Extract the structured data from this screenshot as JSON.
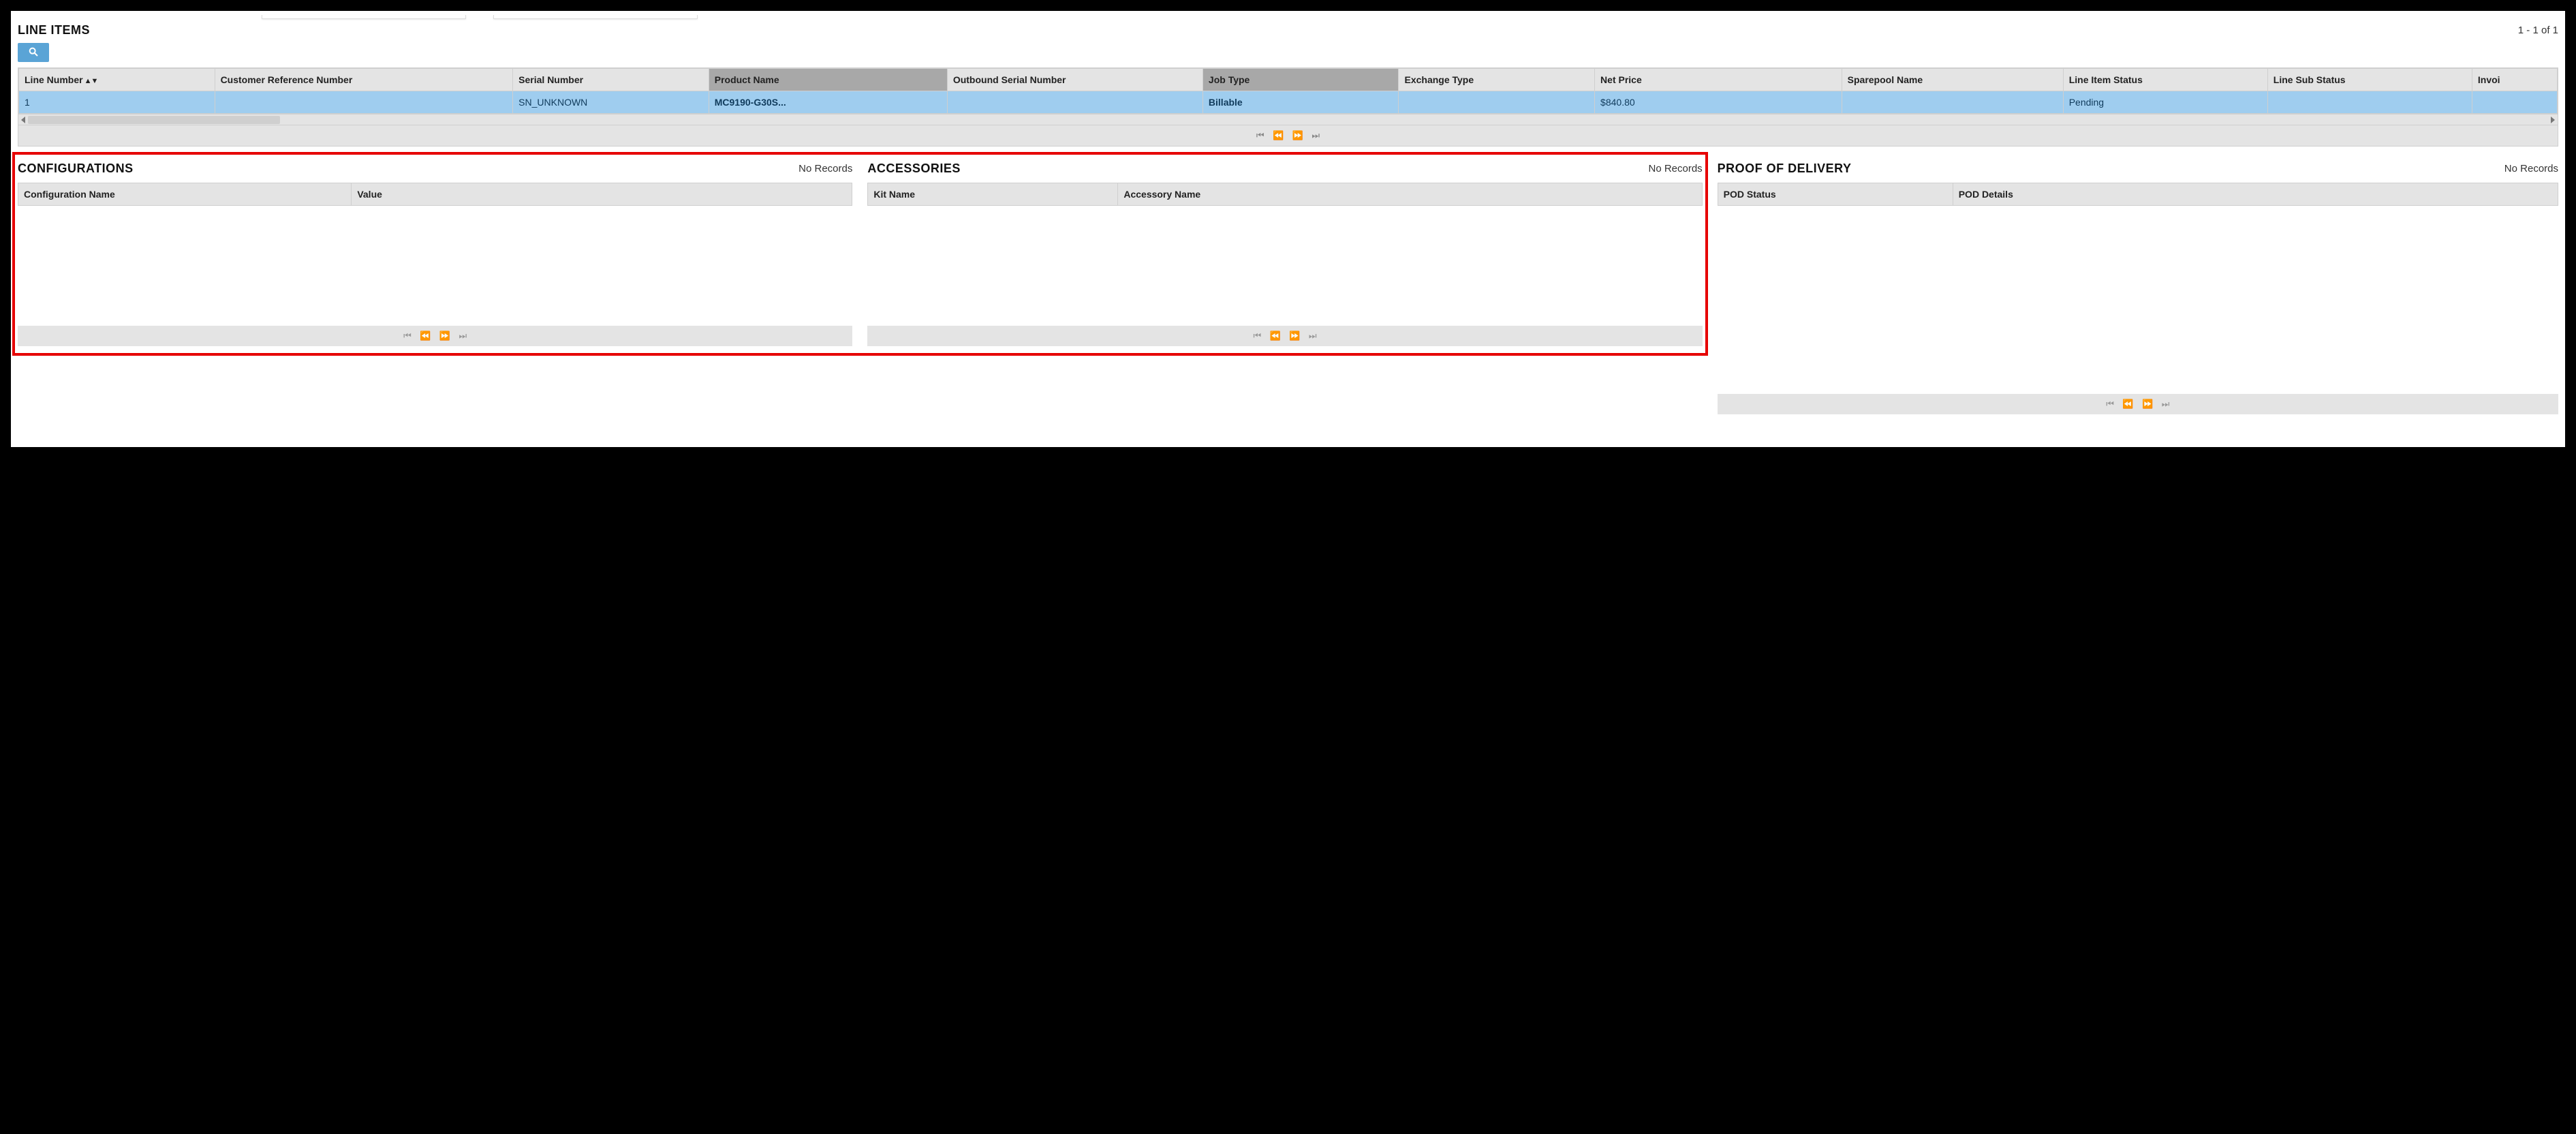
{
  "line_items": {
    "title": "LINE ITEMS",
    "status": "1 - 1 of 1",
    "columns": {
      "line_number": "Line Number",
      "customer_ref": "Customer Reference Number",
      "serial_number": "Serial Number",
      "product_name": "Product Name",
      "outbound_serial": "Outbound Serial Number",
      "job_type": "Job Type",
      "exchange_type": "Exchange Type",
      "net_price": "Net Price",
      "sparepool_name": "Sparepool Name",
      "line_item_status": "Line Item Status",
      "line_sub_status": "Line Sub Status",
      "invoice": "Invoi"
    },
    "row": {
      "line_number": "1",
      "customer_ref": "",
      "serial_number": "SN_UNKNOWN",
      "product_name": "MC9190-G30S...",
      "outbound_serial": "",
      "job_type": "Billable",
      "exchange_type": "",
      "net_price": "$840.80",
      "sparepool_name": "",
      "line_item_status": "Pending",
      "line_sub_status": "",
      "invoice": ""
    }
  },
  "configurations": {
    "title": "CONFIGURATIONS",
    "status": "No Records",
    "columns": {
      "config_name": "Configuration Name",
      "value": "Value"
    }
  },
  "accessories": {
    "title": "ACCESSORIES",
    "status": "No Records",
    "columns": {
      "kit_name": "Kit Name",
      "accessory_name": "Accessory Name"
    }
  },
  "proof_of_delivery": {
    "title": "PROOF OF DELIVERY",
    "status": "No Records",
    "columns": {
      "pod_status": "POD Status",
      "pod_details": "POD Details"
    }
  }
}
